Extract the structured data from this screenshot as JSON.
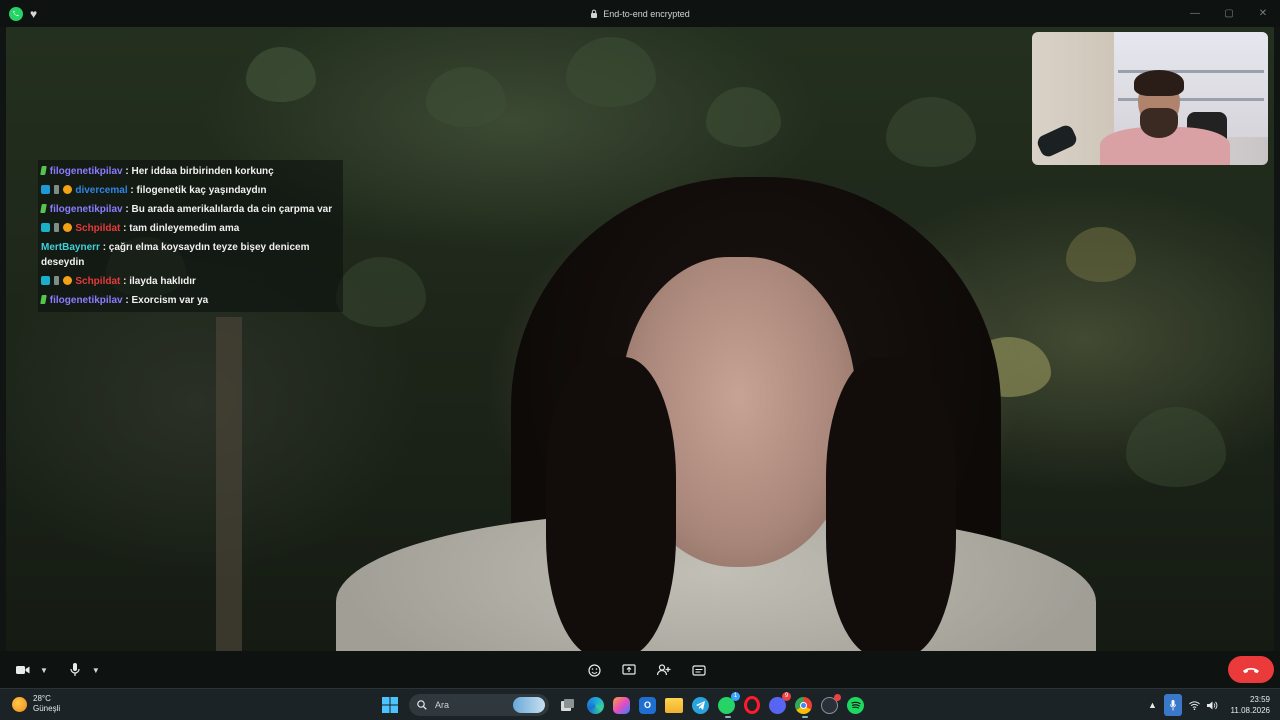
{
  "titlebar": {
    "encryption_text": "End-to-end encrypted",
    "app_icon": "whatsapp-icon",
    "favorite_icon": "heart-icon"
  },
  "chat": {
    "messages": [
      {
        "user": "filogenetikpilav",
        "text": ": Her iddaa birbirinden korkunç",
        "badges": [
          "green"
        ],
        "color": "#8a7cff"
      },
      {
        "user": "divercemal",
        "text": ": filogenetik kaç yaşındaydın",
        "badges": [
          "blue",
          "gray",
          "orange"
        ],
        "color": "#2e86e6"
      },
      {
        "user": "filogenetikpilav",
        "text": ": Bu arada amerikalılarda da cin çarpma var",
        "badges": [
          "green"
        ],
        "color": "#8a7cff"
      },
      {
        "user": "Schpildat",
        "text": ": tam dinleyemedim ama",
        "badges": [
          "hype",
          "gray",
          "orange"
        ],
        "color": "#e53b3b"
      },
      {
        "user": "MertBaynerr",
        "text": ": çağrı elma koysaydın teyze bişey denicem deseydin",
        "badges": [],
        "color": "#3fd0d9"
      },
      {
        "user": "Schpildat",
        "text": ": ilayda haklıdır",
        "badges": [
          "hype",
          "gray",
          "orange"
        ],
        "color": "#e53b3b"
      },
      {
        "user": "filogenetikpilav",
        "text": ": Exorcism var ya",
        "badges": [
          "green"
        ],
        "color": "#8a7cff"
      }
    ]
  },
  "controls": {
    "left": [
      "camera-icon",
      "chevron-down-icon",
      "microphone-icon",
      "chevron-down-icon"
    ],
    "center": [
      "emoji-icon",
      "screen-share-icon",
      "add-person-icon",
      "captions-icon"
    ],
    "end_call_icon": "end-call-icon",
    "end_call_color": "#ea3a3a"
  },
  "taskbar": {
    "weather": {
      "temp": "28°C",
      "condition": "Güneşli"
    },
    "search_placeholder": "Ara",
    "apps": [
      "start-icon",
      "search-icon",
      "task-view-icon",
      "edge-icon",
      "copilot-icon",
      "outlook-icon",
      "file-explorer-icon",
      "telegram-icon",
      "whatsapp-icon",
      "opera-icon",
      "discord-icon",
      "chrome-icon",
      "steam-icon",
      "spotify-icon"
    ],
    "whatsapp_badge": "1",
    "discord_badge": "9",
    "clock": {
      "time": "23:59",
      "date": "11.08.2026"
    }
  }
}
